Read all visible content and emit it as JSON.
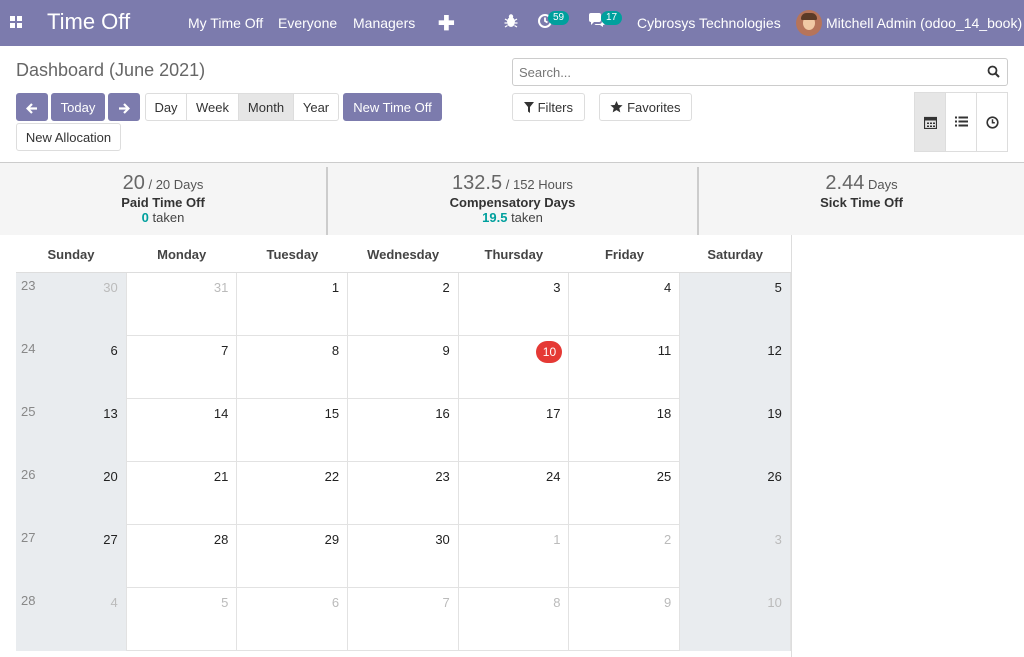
{
  "navbar": {
    "app_title": "Time Off",
    "menu": [
      "My Time Off",
      "Everyone",
      "Managers"
    ],
    "activity_count": "59",
    "message_count": "17",
    "company": "Cybrosys Technologies",
    "user": "Mitchell Admin (odoo_14_book)"
  },
  "control": {
    "title": "Dashboard (June 2021)",
    "search_placeholder": "Search...",
    "today_label": "Today",
    "scales": [
      "Day",
      "Week",
      "Month",
      "Year"
    ],
    "active_scale": "Month",
    "new_time_off_label": "New Time Off",
    "new_allocation_label": "New Allocation",
    "filters_label": "Filters",
    "favorites_label": "Favorites",
    "active_view": "calendar"
  },
  "summary": [
    {
      "value": "20",
      "total": "/ 20 Days",
      "name": "Paid Time Off",
      "taken_value": "0",
      "taken_label": "taken"
    },
    {
      "value": "132.5",
      "total": "/ 152 Hours",
      "name": "Compensatory Days",
      "taken_value": "19.5",
      "taken_label": "taken"
    },
    {
      "value": "2.44",
      "total": "Days",
      "name": "Sick Time Off",
      "taken_value": "",
      "taken_label": ""
    }
  ],
  "calendar": {
    "weekdays": [
      "Sunday",
      "Monday",
      "Tuesday",
      "Wednesday",
      "Thursday",
      "Friday",
      "Saturday"
    ],
    "weeks": [
      {
        "week": "23",
        "days": [
          "30",
          "31",
          "1",
          "2",
          "3",
          "4",
          "5"
        ]
      },
      {
        "week": "24",
        "days": [
          "6",
          "7",
          "8",
          "9",
          "10",
          "11",
          "12"
        ]
      },
      {
        "week": "25",
        "days": [
          "13",
          "14",
          "15",
          "16",
          "17",
          "18",
          "19"
        ]
      },
      {
        "week": "26",
        "days": [
          "20",
          "21",
          "22",
          "23",
          "24",
          "25",
          "26"
        ]
      },
      {
        "week": "27",
        "days": [
          "27",
          "28",
          "29",
          "30",
          "1",
          "2",
          "3"
        ]
      },
      {
        "week": "28",
        "days": [
          "4",
          "5",
          "6",
          "7",
          "8",
          "9",
          "10"
        ]
      }
    ],
    "today": "10",
    "colors": {
      "accent": "#7c7bad",
      "today": "#e53935",
      "teal": "#00a09d",
      "weekend": "#e9ecef"
    }
  }
}
